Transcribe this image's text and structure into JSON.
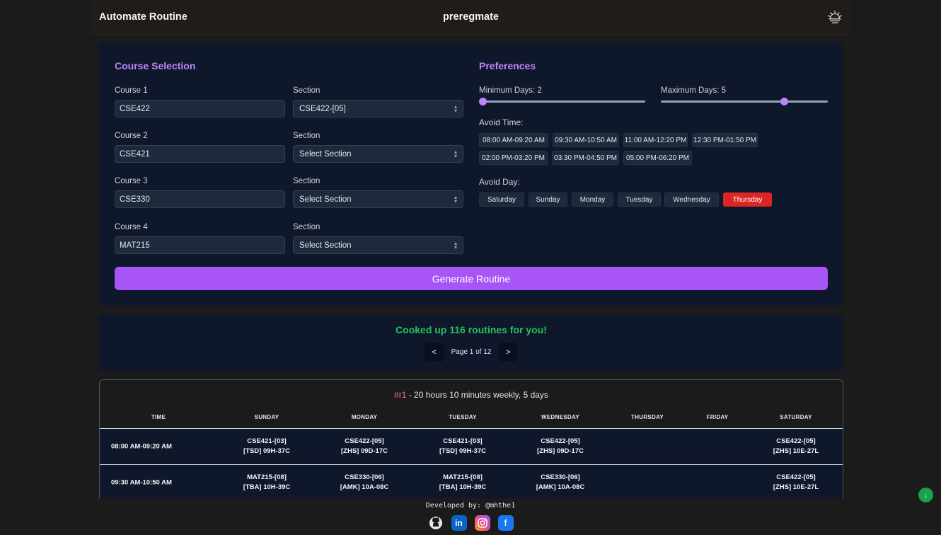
{
  "header": {
    "left_title": "Automate Routine",
    "brand": "preregmate"
  },
  "course_selection": {
    "title": "Course Selection",
    "section_label": "Section",
    "courses": [
      {
        "label": "Course 1",
        "value": "CSE422",
        "section": "CSE422-[05]"
      },
      {
        "label": "Course 2",
        "value": "CSE421",
        "section": "Select Section"
      },
      {
        "label": "Course 3",
        "value": "CSE330",
        "section": "Select Section"
      },
      {
        "label": "Course 4",
        "value": "MAT215",
        "section": "Select Section"
      }
    ]
  },
  "preferences": {
    "title": "Preferences",
    "min_days_label": "Minimum Days: 2",
    "max_days_label": "Maximum Days: 5",
    "min_days": 2,
    "max_days": 5,
    "avoid_time_label": "Avoid Time:",
    "avoid_times": [
      "08:00 AM-09:20 AM",
      "09:30 AM-10:50 AM",
      "11:00 AM-12:20 PM",
      "12:30 PM-01:50 PM",
      "02:00 PM-03:20 PM",
      "03:30 PM-04:50 PM",
      "05:00 PM-06:20 PM"
    ],
    "avoid_day_label": "Avoid Day:",
    "avoid_days": [
      "Saturday",
      "Sunday",
      "Monday",
      "Tuesday",
      "Wednesday",
      "Thursday"
    ],
    "selected_day": "Thursday"
  },
  "generate_label": "Generate Routine",
  "results": {
    "message": "Cooked up 116 routines for you!",
    "prev": "<",
    "next": ">",
    "page_text": "Page 1 of 12"
  },
  "routine": {
    "number": "#r1",
    "summary": " - 20 hours 10 minutes weekly, 5 days",
    "headers": [
      "TIME",
      "SUNDAY",
      "MONDAY",
      "TUESDAY",
      "WEDNESDAY",
      "THURSDAY",
      "FRIDAY",
      "SATURDAY"
    ],
    "rows": [
      {
        "time": "08:00 AM-09:20 AM",
        "sunday": [
          "CSE421-[03]",
          "[TSD] 09H-37C"
        ],
        "monday": [
          "CSE422-[05]",
          "[ZHS] 09D-17C"
        ],
        "tuesday": [
          "CSE421-[03]",
          "[TSD] 09H-37C"
        ],
        "wednesday": [
          "CSE422-[05]",
          "[ZHS] 09D-17C"
        ],
        "saturday": [
          "CSE422-[05]",
          "[ZHS] 10E-27L"
        ]
      },
      {
        "time": "09:30 AM-10:50 AM",
        "sunday": [
          "MAT215-[08]",
          "[TBA] 10H-39C"
        ],
        "monday": [
          "CSE330-[06]",
          "[AMK] 10A-08C"
        ],
        "tuesday": [
          "MAT215-[08]",
          "[TBA] 10H-39C"
        ],
        "wednesday": [
          "CSE330-[06]",
          "[AMK] 10A-08C"
        ],
        "saturday": [
          "CSE422-[05]",
          "[ZHS] 10E-27L"
        ]
      }
    ]
  },
  "footer": {
    "developed_by": "Developed by: @mhthe1"
  },
  "colors": {
    "accent": "#a855f7",
    "success": "#22c55e",
    "danger": "#dc2626",
    "panel": "#0f172a"
  }
}
